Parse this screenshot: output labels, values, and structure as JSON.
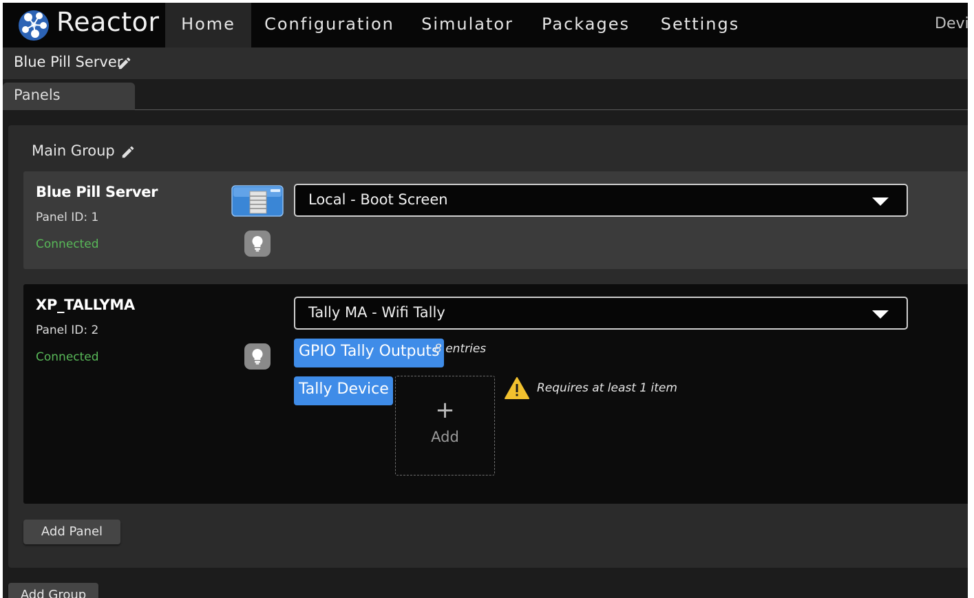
{
  "nav": {
    "brand": "Reactor",
    "items": [
      {
        "label": "Home",
        "active": true
      },
      {
        "label": "Configuration",
        "active": false
      },
      {
        "label": "Simulator",
        "active": false
      },
      {
        "label": "Packages",
        "active": false
      },
      {
        "label": "Settings",
        "active": false
      }
    ],
    "partial_item": "Devi"
  },
  "titlebar": {
    "title": "Blue Pill Server",
    "edit_icon": "pencil-icon"
  },
  "tabs": [
    {
      "label": "Panels",
      "active": true
    }
  ],
  "group": {
    "title": "Main Group",
    "edit_icon": "pencil-icon",
    "panels": [
      {
        "name": "Blue Pill Server",
        "panel_id": "Panel ID: 1",
        "status": "Connected",
        "device_icon": "server-icon",
        "identify_icon": "lightbulb-icon",
        "selected_config": "Local - Boot Screen"
      },
      {
        "name": "XP_TALLYMA",
        "panel_id": "Panel ID: 2",
        "status": "Connected",
        "identify_icon": "lightbulb-icon",
        "selected_config": "Tally MA - Wifi Tally",
        "gpio_chip": "GPIO Tally Outputs",
        "gpio_entries": "8 entries",
        "tally_chip": "Tally Device",
        "add_plus": "+",
        "add_label": "Add",
        "warning": "Requires at least 1 item"
      }
    ],
    "add_panel_label": "Add Panel"
  },
  "add_group_label": "Add Group",
  "colors": {
    "nav_bg": "#070707",
    "connected": "#58b858",
    "chip_blue": "#3f8ce8",
    "warning_yellow": "#f2c12e"
  }
}
